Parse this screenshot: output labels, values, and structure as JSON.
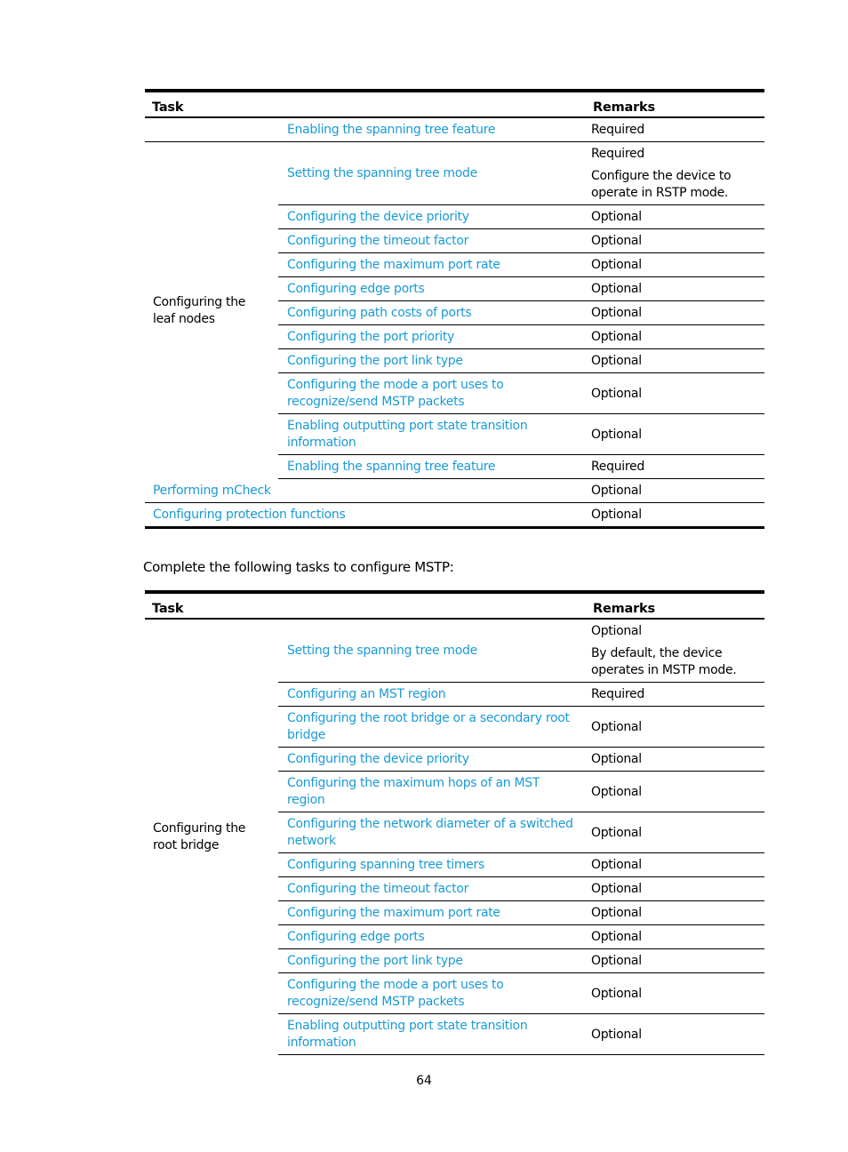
{
  "table1": {
    "headers": {
      "task": "Task",
      "remarks": "Remarks"
    },
    "top_row": {
      "task": "Enabling the spanning tree feature",
      "remarks": [
        "Required"
      ]
    },
    "group": {
      "label": "Configuring the leaf nodes",
      "rows": [
        {
          "task": "Setting the spanning tree mode",
          "remarks": [
            "Required",
            "Configure the device to operate in RSTP mode."
          ]
        },
        {
          "task": "Configuring the device priority",
          "remarks": [
            "Optional"
          ]
        },
        {
          "task": "Configuring the timeout factor",
          "remarks": [
            "Optional"
          ]
        },
        {
          "task": "Configuring the maximum port rate",
          "remarks": [
            "Optional"
          ]
        },
        {
          "task": "Configuring edge ports",
          "remarks": [
            "Optional"
          ]
        },
        {
          "task": "Configuring path costs of ports",
          "remarks": [
            "Optional"
          ]
        },
        {
          "task": "Configuring the port priority",
          "remarks": [
            "Optional"
          ]
        },
        {
          "task": "Configuring the port link type",
          "remarks": [
            "Optional"
          ]
        },
        {
          "task": "Configuring the mode a port uses to recognize/send MSTP packets",
          "remarks": [
            "Optional"
          ]
        },
        {
          "task": "Enabling outputting port state transition information",
          "remarks": [
            "Optional"
          ]
        },
        {
          "task": "Enabling the spanning tree feature",
          "remarks": [
            "Required"
          ]
        }
      ]
    },
    "bottom_rows": [
      {
        "task": "Performing mCheck",
        "remarks": "Optional"
      },
      {
        "task": "Configuring protection functions",
        "remarks": "Optional"
      }
    ]
  },
  "intro_text": "Complete the following tasks to configure MSTP:",
  "table2": {
    "headers": {
      "task": "Task",
      "remarks": "Remarks"
    },
    "group": {
      "label": "Configuring the root bridge",
      "rows": [
        {
          "task": "Setting the spanning tree mode",
          "remarks": [
            "Optional",
            "By default, the device operates in MSTP mode."
          ]
        },
        {
          "task": "Configuring an MST region",
          "remarks": [
            "Required"
          ]
        },
        {
          "task": "Configuring the root bridge or a secondary root bridge",
          "remarks": [
            "Optional"
          ]
        },
        {
          "task": "Configuring the device priority",
          "remarks": [
            "Optional"
          ]
        },
        {
          "task": "Configuring the maximum hops of an MST region",
          "remarks": [
            "Optional"
          ]
        },
        {
          "task": "Configuring the network diameter of a switched network",
          "remarks": [
            "Optional"
          ]
        },
        {
          "task": "Configuring spanning tree timers",
          "remarks": [
            "Optional"
          ]
        },
        {
          "task": "Configuring the timeout factor",
          "remarks": [
            "Optional"
          ]
        },
        {
          "task": "Configuring the maximum port rate",
          "remarks": [
            "Optional"
          ]
        },
        {
          "task": "Configuring edge ports",
          "remarks": [
            "Optional"
          ]
        },
        {
          "task": "Configuring the port link type",
          "remarks": [
            "Optional"
          ]
        },
        {
          "task": "Configuring the mode a port uses to recognize/send MSTP packets",
          "remarks": [
            "Optional"
          ]
        },
        {
          "task": "Enabling outputting port state transition information",
          "remarks": [
            "Optional"
          ]
        }
      ]
    }
  },
  "page_number": "64",
  "colors": {
    "link": "#1a9ad6",
    "text": "#000000"
  }
}
